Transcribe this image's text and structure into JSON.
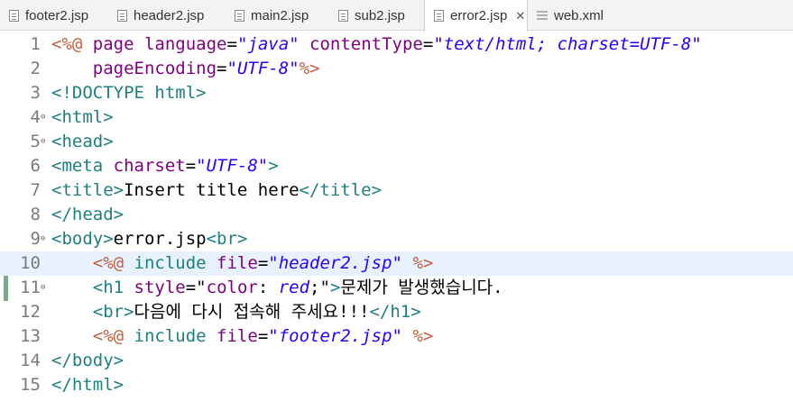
{
  "tabs": [
    {
      "label": "footer2.jsp",
      "icon": "jsp-file-icon",
      "active": false
    },
    {
      "label": "header2.jsp",
      "icon": "jsp-file-icon",
      "active": false
    },
    {
      "label": "main2.jsp",
      "icon": "jsp-file-icon",
      "active": false
    },
    {
      "label": "sub2.jsp",
      "icon": "jsp-file-icon",
      "active": false
    },
    {
      "label": "error2.jsp",
      "icon": "jsp-file-icon",
      "active": true,
      "close": "✕"
    },
    {
      "label": "web.xml",
      "icon": "xml-file-icon",
      "active": false
    }
  ],
  "editor": {
    "current_line": 10,
    "lines": [
      {
        "n": "1",
        "tokens": [
          [
            "d",
            "<%@ "
          ],
          [
            "a",
            "page "
          ],
          [
            "a",
            "language"
          ],
          [
            "p",
            "="
          ],
          [
            "v",
            "\"java\""
          ],
          [
            "p",
            " "
          ],
          [
            "a",
            "contentType"
          ],
          [
            "p",
            "="
          ],
          [
            "v",
            "\"text/html; charset=UTF-8\""
          ]
        ]
      },
      {
        "n": "2",
        "tokens": [
          [
            "p",
            "    "
          ],
          [
            "a",
            "pageEncoding"
          ],
          [
            "p",
            "="
          ],
          [
            "v",
            "\"UTF-8\""
          ],
          [
            "d",
            "%>"
          ]
        ]
      },
      {
        "n": "3",
        "tokens": [
          [
            "t",
            "<!DOCTYPE "
          ],
          [
            "t",
            "html"
          ],
          [
            "t",
            ">"
          ]
        ]
      },
      {
        "n": "4",
        "fold": true,
        "tokens": [
          [
            "t",
            "<html>"
          ]
        ]
      },
      {
        "n": "5",
        "fold": true,
        "tokens": [
          [
            "t",
            "<head>"
          ]
        ]
      },
      {
        "n": "6",
        "tokens": [
          [
            "t",
            "<meta "
          ],
          [
            "a",
            "charset"
          ],
          [
            "p",
            "="
          ],
          [
            "v",
            "\"UTF-8\""
          ],
          [
            "t",
            ">"
          ]
        ]
      },
      {
        "n": "7",
        "tokens": [
          [
            "t",
            "<title>"
          ],
          [
            "p",
            "Insert title here"
          ],
          [
            "t",
            "</title>"
          ]
        ]
      },
      {
        "n": "8",
        "tokens": [
          [
            "t",
            "</head>"
          ]
        ]
      },
      {
        "n": "9",
        "fold": true,
        "tokens": [
          [
            "t",
            "<body>"
          ],
          [
            "p",
            "error.jsp"
          ],
          [
            "t",
            "<br>"
          ]
        ]
      },
      {
        "n": "10",
        "tokens": [
          [
            "p",
            "    "
          ],
          [
            "d",
            "<%@ "
          ],
          [
            "t",
            "include "
          ],
          [
            "a",
            "file"
          ],
          [
            "p",
            "="
          ],
          [
            "v",
            "\"header2.jsp\""
          ],
          [
            "p",
            " "
          ],
          [
            "d",
            "%>"
          ]
        ]
      },
      {
        "n": "11",
        "fold": true,
        "tokens": [
          [
            "p",
            "    "
          ],
          [
            "t",
            "<h1 "
          ],
          [
            "a",
            "style"
          ],
          [
            "p",
            "=\""
          ],
          [
            "a",
            "color"
          ],
          [
            "p",
            ": "
          ],
          [
            "v",
            "red"
          ],
          [
            "p",
            ";\""
          ],
          [
            "t",
            ">"
          ],
          [
            "p",
            "문제가 발생했습니다."
          ]
        ]
      },
      {
        "n": "12",
        "tokens": [
          [
            "p",
            "    "
          ],
          [
            "t",
            "<br>"
          ],
          [
            "p",
            "다음에 다시 접속해 주세요!!!"
          ],
          [
            "t",
            "</h1>"
          ]
        ]
      },
      {
        "n": "13",
        "tokens": [
          [
            "p",
            "    "
          ],
          [
            "d",
            "<%@ "
          ],
          [
            "t",
            "include "
          ],
          [
            "a",
            "file"
          ],
          [
            "p",
            "="
          ],
          [
            "v",
            "\"footer2.jsp\""
          ],
          [
            "p",
            " "
          ],
          [
            "d",
            "%>"
          ]
        ]
      },
      {
        "n": "14",
        "tokens": [
          [
            "t",
            "</body>"
          ]
        ]
      },
      {
        "n": "15",
        "tokens": [
          [
            "t",
            "</html>"
          ]
        ]
      }
    ]
  }
}
